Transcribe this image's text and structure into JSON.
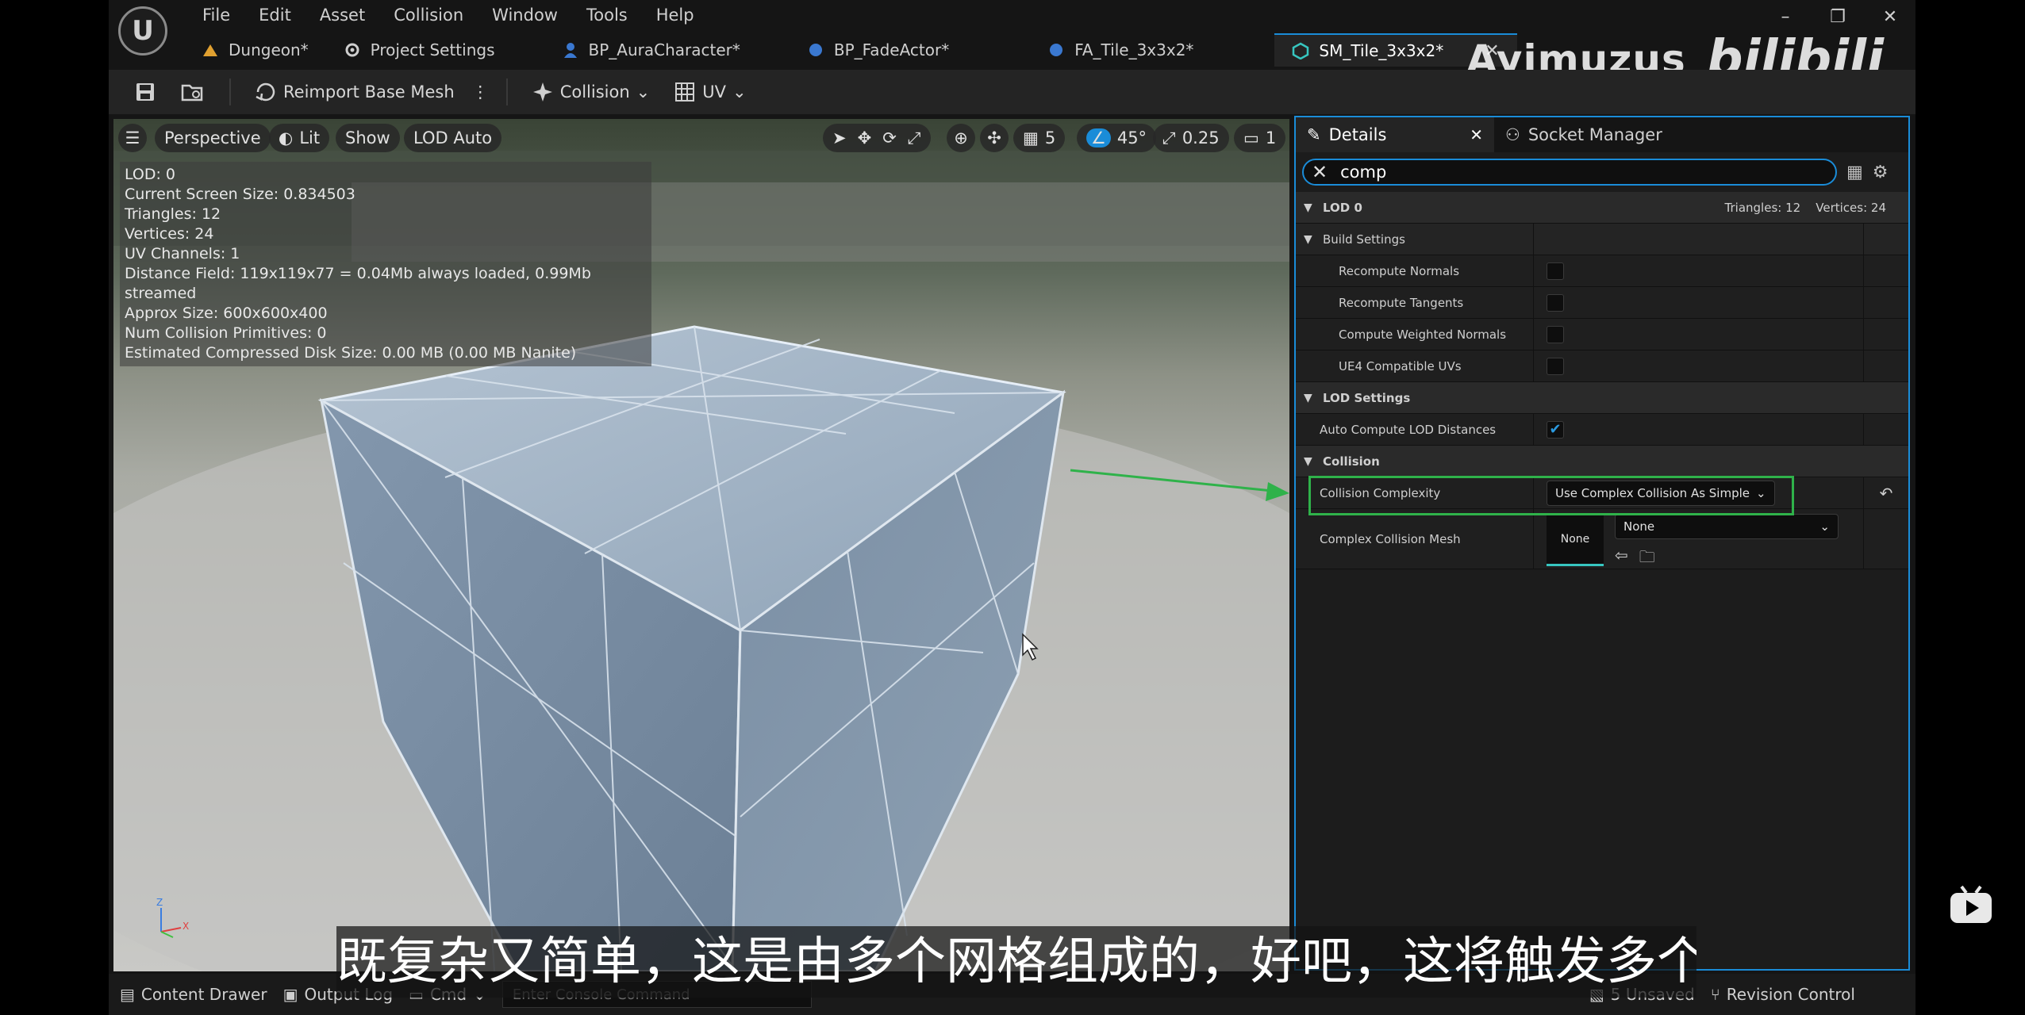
{
  "menu": [
    "File",
    "Edit",
    "Asset",
    "Collision",
    "Window",
    "Tools",
    "Help"
  ],
  "tabs": [
    {
      "label": "Dungeon*",
      "icon": "level-icon"
    },
    {
      "label": "Project Settings",
      "icon": "settings-icon"
    },
    {
      "label": "BP_AuraCharacter*",
      "icon": "blueprint-icon"
    },
    {
      "label": "BP_FadeActor*",
      "icon": "blueprint-icon"
    },
    {
      "label": "FA_Tile_3x3x2*",
      "icon": "blueprint-icon"
    },
    {
      "label": "SM_Tile_3x3x2*",
      "icon": "static-mesh-icon",
      "active": true
    }
  ],
  "watermark": {
    "name": "Ayimuzus",
    "site": "bilibili"
  },
  "toolbar": {
    "reimport": "Reimport Base Mesh",
    "collision": "Collision",
    "uv": "UV"
  },
  "viewport": {
    "menu_icon": "hamburger-icon",
    "perspective": "Perspective",
    "lit": "Lit",
    "show": "Show",
    "lod": "LOD Auto",
    "grid_snap": "5",
    "rot_snap": "45°",
    "scale_snap": "0.25",
    "camera_speed": "1",
    "stats": [
      "LOD:  0",
      "Current Screen Size:  0.834503",
      "Triangles:  12",
      "Vertices:  24",
      "UV Channels:  1",
      "Distance Field:  119x119x77 = 0.04Mb always loaded, 0.99Mb streamed",
      "Approx Size: 600x600x400",
      "Num Collision Primitives:  0",
      "Estimated Compressed Disk Size: 0.00 MB (0.00 MB Nanite)"
    ]
  },
  "details": {
    "tab_details": "Details",
    "tab_socket": "Socket Manager",
    "search_value": "comp",
    "lod0": {
      "label": "LOD 0",
      "summary": "Triangles: 12    Vertices: 24"
    },
    "build_settings": "Build Settings",
    "build_props": [
      {
        "label": "Recompute Normals",
        "checked": false
      },
      {
        "label": "Recompute Tangents",
        "checked": false
      },
      {
        "label": "Compute Weighted Normals",
        "checked": false
      },
      {
        "label": "UE4 Compatible UVs",
        "checked": false
      }
    ],
    "lod_settings": "LOD Settings",
    "auto_lod": {
      "label": "Auto Compute LOD Distances",
      "checked": true
    },
    "collision": "Collision",
    "collision_complexity": {
      "label": "Collision Complexity",
      "value": "Use Complex Collision As Simple"
    },
    "complex_mesh": {
      "label": "Complex Collision Mesh",
      "thumb": "None",
      "value": "None"
    }
  },
  "statusbar": {
    "content_drawer": "Content Drawer",
    "output_log": "Output Log",
    "cmd": "Cmd",
    "console_placeholder": "Enter Console Command",
    "unsaved": "5 Unsaved",
    "revision": "Revision Control"
  },
  "subtitle": "既复杂又简单，这是由多个网格组成的，好吧，这将触发多个",
  "colors": {
    "accent": "#1a8cd8",
    "highlight": "#2fb24a",
    "background": "#151515"
  }
}
